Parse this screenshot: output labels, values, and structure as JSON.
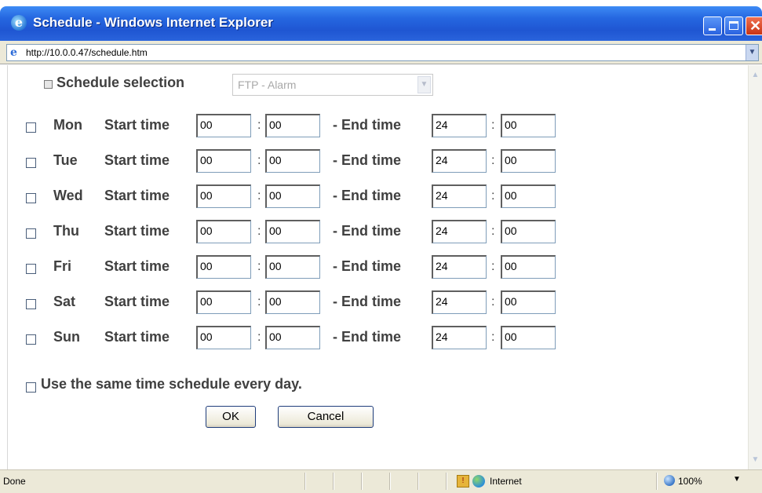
{
  "window": {
    "title": "Schedule - Windows Internet Explorer",
    "address": "http://10.0.0.47/schedule.htm"
  },
  "schedule": {
    "selection_label": "Schedule selection",
    "selection_value": "FTP - Alarm",
    "start_label": "Start time",
    "end_label": "- End time",
    "colon": ":",
    "days": [
      {
        "name": "Mon",
        "start_h": "00",
        "start_m": "00",
        "end_h": "24",
        "end_m": "00"
      },
      {
        "name": "Tue",
        "start_h": "00",
        "start_m": "00",
        "end_h": "24",
        "end_m": "00"
      },
      {
        "name": "Wed",
        "start_h": "00",
        "start_m": "00",
        "end_h": "24",
        "end_m": "00"
      },
      {
        "name": "Thu",
        "start_h": "00",
        "start_m": "00",
        "end_h": "24",
        "end_m": "00"
      },
      {
        "name": "Fri",
        "start_h": "00",
        "start_m": "00",
        "end_h": "24",
        "end_m": "00"
      },
      {
        "name": "Sat",
        "start_h": "00",
        "start_m": "00",
        "end_h": "24",
        "end_m": "00"
      },
      {
        "name": "Sun",
        "start_h": "00",
        "start_m": "00",
        "end_h": "24",
        "end_m": "00"
      }
    ],
    "same_schedule_label": "Use the same time schedule every day.",
    "ok_label": "OK",
    "cancel_label": "Cancel"
  },
  "status": {
    "text": "Done",
    "zone": "Internet",
    "zoom": "100%"
  }
}
